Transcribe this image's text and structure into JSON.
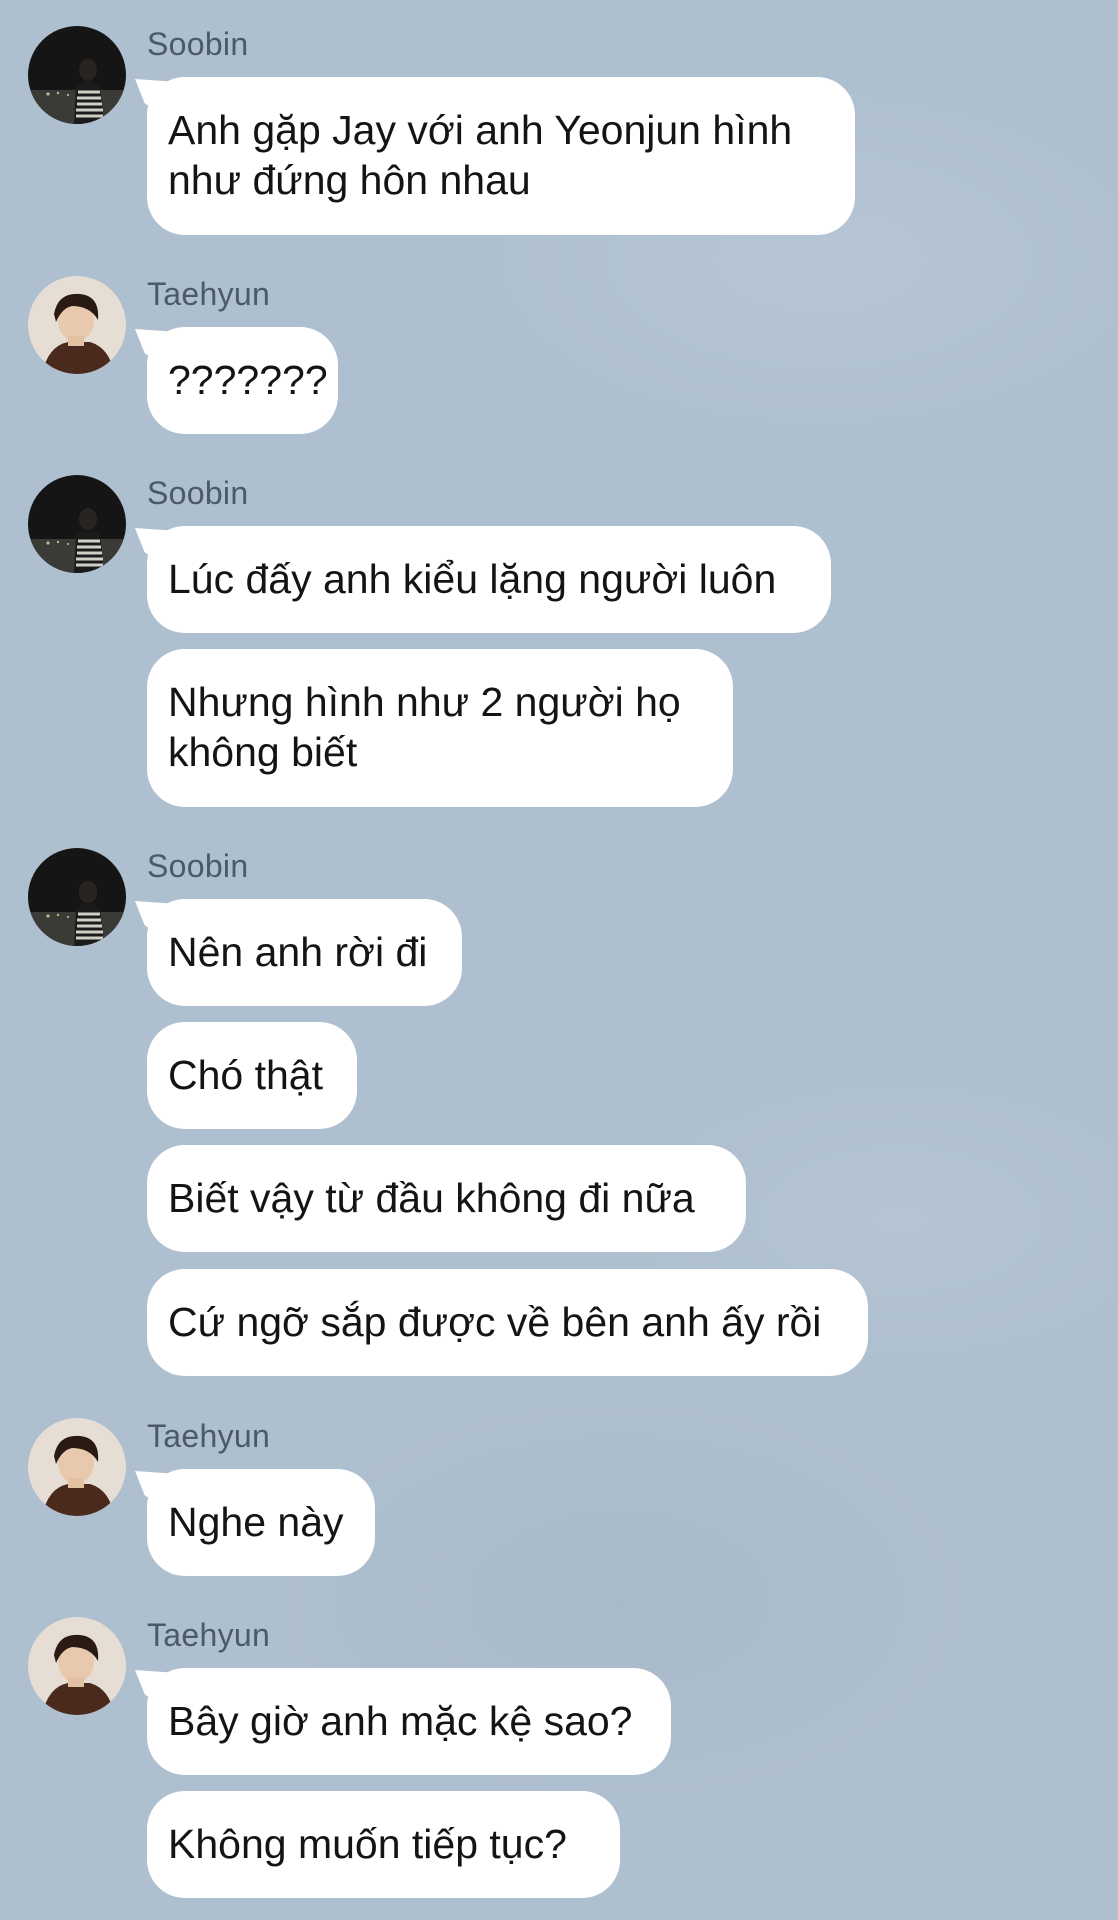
{
  "messages": [
    {
      "sender": "Soobin",
      "avatar_icon": "soobin-avatar",
      "bubbles": [
        "Anh gặp Jay với anh Yeonjun hình như đứng hôn nhau"
      ]
    },
    {
      "sender": "Taehyun",
      "avatar_icon": "taehyun-avatar",
      "bubbles": [
        "???????"
      ]
    },
    {
      "sender": "Soobin",
      "avatar_icon": "soobin-avatar",
      "bubbles": [
        "Lúc đấy anh kiểu lặng người luôn",
        "Nhưng hình như 2 người họ không biết"
      ]
    },
    {
      "sender": "Soobin",
      "avatar_icon": "soobin-avatar",
      "bubbles": [
        "Nên anh rời đi",
        "Chó thật",
        "Biết vậy từ đầu không đi nữa",
        "Cứ ngỡ sắp được về bên anh ấy rồi"
      ]
    },
    {
      "sender": "Taehyun",
      "avatar_icon": "taehyun-avatar",
      "bubbles": [
        "Nghe này"
      ]
    },
    {
      "sender": "Taehyun",
      "avatar_icon": "taehyun-avatar",
      "bubbles": [
        "Bây giờ anh mặc kệ sao?",
        "Không muốn tiếp tục?"
      ]
    }
  ],
  "colors": {
    "background": "#aebfcf",
    "bubble": "#ffffff",
    "sender_name": "#4b5a69",
    "message_text": "#141414"
  }
}
